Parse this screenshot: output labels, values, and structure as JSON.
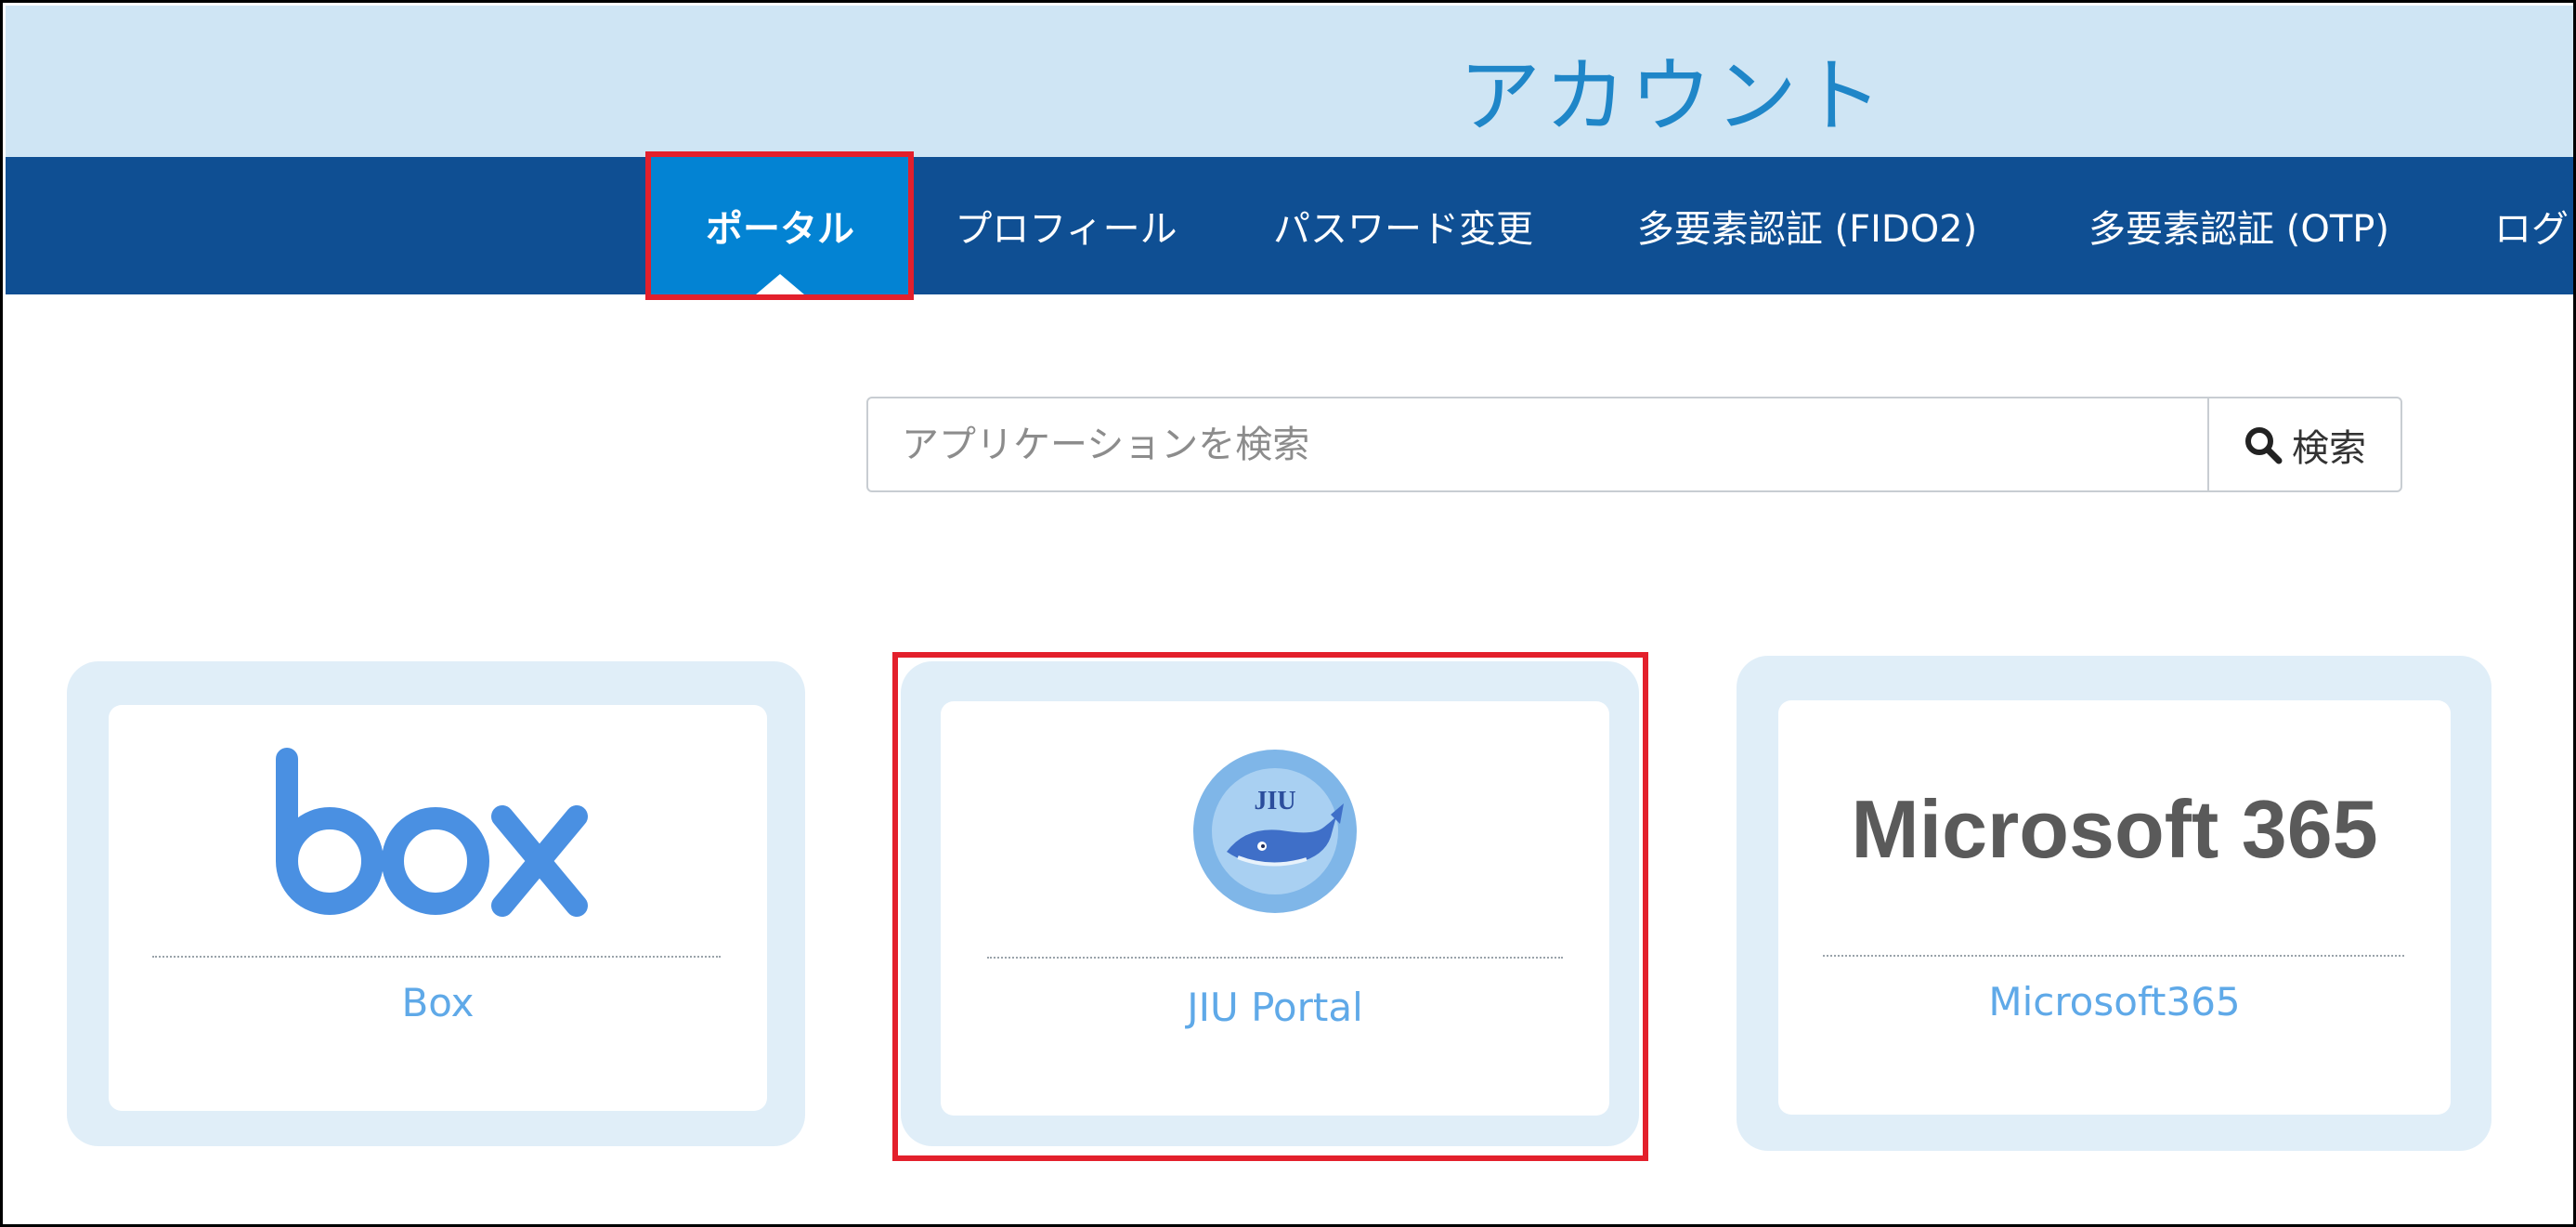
{
  "header": {
    "title": "アカウント"
  },
  "nav": {
    "items": [
      {
        "label": "ポータル",
        "active": true
      },
      {
        "label": "プロフィール"
      },
      {
        "label": "パスワード変更"
      },
      {
        "label": "多要素認証 (FIDO2)"
      },
      {
        "label": "多要素認証 (OTP)"
      },
      {
        "label": "ログ"
      }
    ]
  },
  "search": {
    "placeholder": "アプリケーションを検索",
    "button_label": "検索"
  },
  "apps": [
    {
      "name": "Box",
      "logo_text": "box"
    },
    {
      "name": "JIU Portal",
      "logo_text": "JIU"
    },
    {
      "name": "Microsoft365",
      "logo_text": "Microsoft 365"
    }
  ],
  "colors": {
    "header_band": "#cfe5f4",
    "navbar": "#0f4f93",
    "active_tab": "#0383d3",
    "highlight": "#e3202c",
    "box_brand": "#4a90e2",
    "label_link": "#5fa9e8"
  }
}
